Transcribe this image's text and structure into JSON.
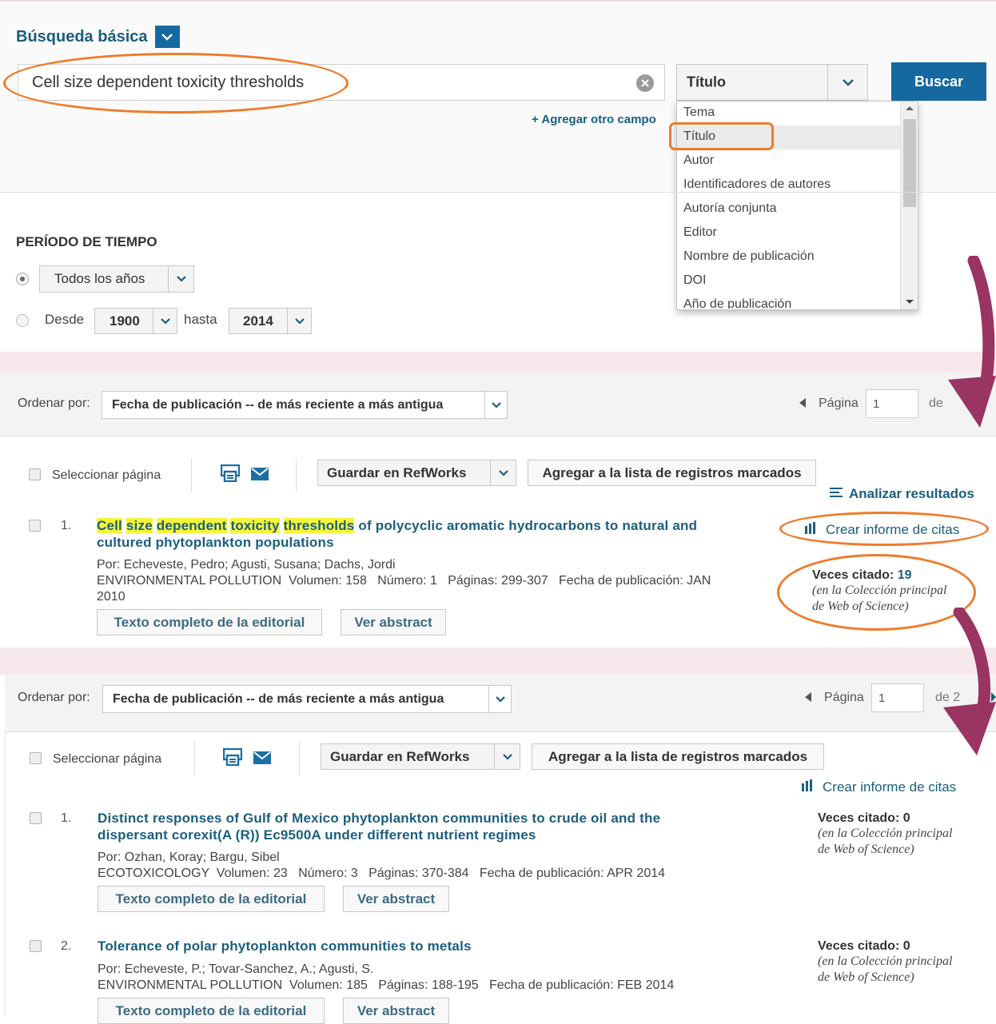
{
  "search": {
    "heading": "Búsqueda básica",
    "query": "Cell size dependent toxicity thresholds",
    "field_selected": "Título",
    "search_button": "Buscar",
    "add_field": "+ Agregar otro campo",
    "field_options": [
      "Tema",
      "Título",
      "Autor",
      "Identificadores de autores",
      "Autoría conjunta",
      "Editor",
      "Nombre de publicación",
      "DOI",
      "Año de publicación"
    ]
  },
  "timespan": {
    "heading": "PERÍODO DE TIEMPO",
    "all_years": "Todos los años",
    "from_label": "Desde",
    "from_year": "1900",
    "to_label": "hasta",
    "to_year": "2014"
  },
  "results1": {
    "sort_label": "Ordenar por:",
    "sort_value": "Fecha de publicación -- de más reciente a más antigua",
    "page_label": "Página",
    "page_value": "1",
    "page_of": "de",
    "select_page": "Seleccionar página",
    "save_to": "Guardar en RefWorks",
    "add_marked": "Agregar a la lista de registros marcados",
    "analyze": "Analizar resultados",
    "citation_report": "Crear informe de citas",
    "record": {
      "num": "1.",
      "title_hl": [
        "Cell",
        "size",
        "dependent",
        "toxicity",
        "thresholds"
      ],
      "title_rest1": "of polycyclic aromatic hydrocarbons to natural and",
      "title_rest2": "cultured phytoplankton populations",
      "authors": "Por: Echeveste, Pedro; Agusti, Susana; Dachs, Jordi",
      "source": "ENVIRONMENTAL POLLUTION  Volumen: 158   Número: 1   Páginas: 299-307   Fecha de publicación: JAN",
      "source2": "2010",
      "fulltext": "Texto completo de la editorial",
      "abstract": "Ver abstract",
      "cited_label": "Veces citado:",
      "cited_count": "19",
      "cited_note1": "(en la Colección principal",
      "cited_note2": "de Web of Science)"
    }
  },
  "results2": {
    "sort_label": "Ordenar por:",
    "sort_value": "Fecha de publicación -- de más reciente a más antigua",
    "page_label": "Página",
    "page_value": "1",
    "page_of": "de 2",
    "select_page": "Seleccionar página",
    "save_to": "Guardar en RefWorks",
    "add_marked": "Agregar a la lista de registros marcados",
    "citation_report": "Crear informe de citas",
    "records": [
      {
        "num": "1.",
        "title1": "Distinct responses of Gulf of Mexico phytoplankton communities to crude oil and the",
        "title2": "dispersant corexit(A (R)) Ec9500A under different nutrient regimes",
        "authors": "Por: Ozhan, Koray; Bargu, Sibel",
        "source": "ECOTOXICOLOGY  Volumen: 23   Número: 3   Páginas: 370-384   Fecha de publicación: APR 2014",
        "fulltext": "Texto completo de la editorial",
        "abstract": "Ver abstract",
        "cited": "Veces citado: 0",
        "cited_note1": "(en la Colección principal",
        "cited_note2": "de Web of Science)"
      },
      {
        "num": "2.",
        "title1": "Tolerance of polar phytoplankton communities to metals",
        "authors": "Por: Echeveste, P.; Tovar-Sanchez, A.; Agusti, S.",
        "source": "ENVIRONMENTAL POLLUTION  Volumen: 185   Páginas: 188-195   Fecha de publicación: FEB 2014",
        "fulltext": "Texto completo de la editorial",
        "abstract": "Ver abstract",
        "cited": "Veces citado: 0",
        "cited_note1": "(en la Colección principal",
        "cited_note2": "de Web of Science)"
      }
    ]
  },
  "colors": {
    "accent": "#1a5e7f",
    "button": "#1668a0",
    "annotation": "#ee7b2a",
    "arrow": "#9a3462",
    "band": "#f6e8ec"
  }
}
